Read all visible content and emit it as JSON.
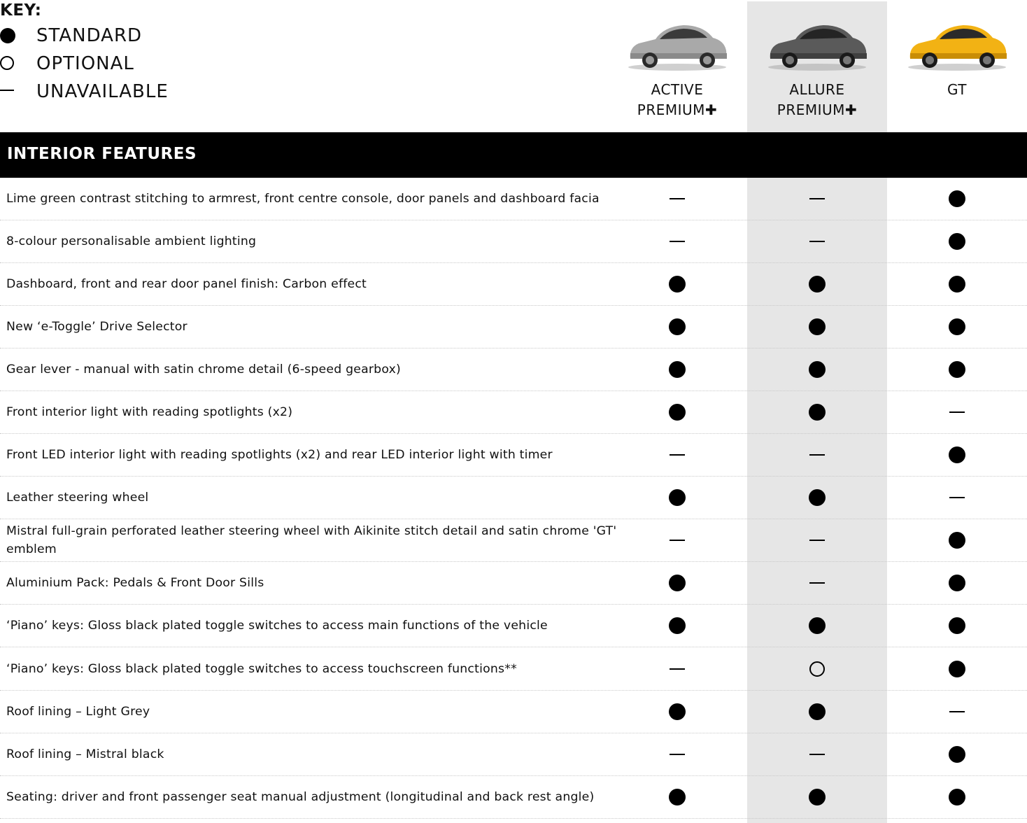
{
  "key": {
    "title": "KEY:",
    "items": [
      {
        "symbol": "standard",
        "label": "STANDARD"
      },
      {
        "symbol": "optional",
        "label": "OPTIONAL"
      },
      {
        "symbol": "unavailable",
        "label": "UNAVAILABLE"
      }
    ]
  },
  "trims": [
    {
      "line1": "ACTIVE",
      "line2": "PREMIUM",
      "plus": "✚",
      "car_color": "silver"
    },
    {
      "line1": "ALLURE",
      "line2": "PREMIUM",
      "plus": "✚",
      "car_color": "dark-grey"
    },
    {
      "line1": "GT",
      "line2": "",
      "plus": "",
      "car_color": "yellow"
    }
  ],
  "section": {
    "title": "INTERIOR FEATURES"
  },
  "rows": [
    {
      "feature": "Lime green contrast stitching to armrest, front centre console, door panels and dashboard facia",
      "values": [
        "unavailable",
        "unavailable",
        "standard"
      ]
    },
    {
      "feature": "8-colour personalisable ambient lighting",
      "values": [
        "unavailable",
        "unavailable",
        "standard"
      ]
    },
    {
      "feature": "Dashboard, front and rear door panel finish: Carbon effect",
      "values": [
        "standard",
        "standard",
        "standard"
      ]
    },
    {
      "feature": "New ‘e-Toggle’ Drive Selector",
      "values": [
        "standard",
        "standard",
        "standard"
      ]
    },
    {
      "feature": "Gear lever - manual with satin chrome detail (6-speed gearbox)",
      "values": [
        "standard",
        "standard",
        "standard"
      ]
    },
    {
      "feature": "Front interior light with reading spotlights (x2)",
      "values": [
        "standard",
        "standard",
        "unavailable"
      ]
    },
    {
      "feature": "Front LED interior light with reading spotlights (x2) and rear LED interior light with timer",
      "values": [
        "unavailable",
        "unavailable",
        "standard"
      ]
    },
    {
      "feature": "Leather steering wheel",
      "values": [
        "standard",
        "standard",
        "unavailable"
      ]
    },
    {
      "feature": "Mistral full-grain perforated leather steering wheel with Aikinite stitch detail and satin chrome 'GT' emblem",
      "values": [
        "unavailable",
        "unavailable",
        "standard"
      ]
    },
    {
      "feature": "Aluminium Pack: Pedals & Front Door Sills",
      "values": [
        "standard",
        "unavailable",
        "standard"
      ]
    },
    {
      "feature": "‘Piano’ keys: Gloss black plated toggle switches to access main functions of the vehicle",
      "values": [
        "standard",
        "standard",
        "standard"
      ]
    },
    {
      "feature": "‘Piano’ keys: Gloss black plated toggle switches to access touchscreen functions**",
      "values": [
        "unavailable",
        "optional",
        "standard"
      ]
    },
    {
      "feature": "Roof lining – Light Grey",
      "values": [
        "standard",
        "standard",
        "unavailable"
      ]
    },
    {
      "feature": "Roof lining – Mistral black",
      "values": [
        "unavailable",
        "unavailable",
        "standard"
      ]
    },
    {
      "feature": "Seating: driver and front passenger seat manual adjustment (longitudinal and back rest angle)",
      "values": [
        "standard",
        "standard",
        "standard"
      ]
    }
  ]
}
